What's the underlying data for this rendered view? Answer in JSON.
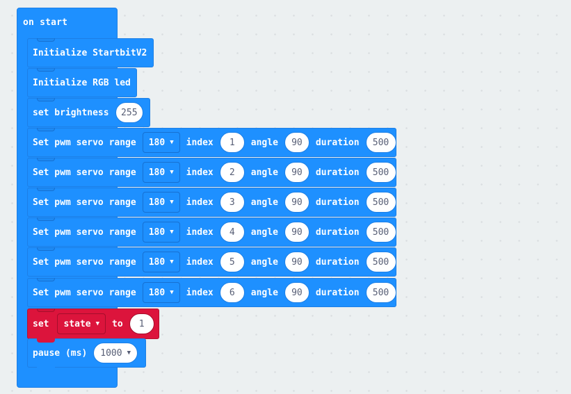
{
  "hat": {
    "label": "on start"
  },
  "blocks": {
    "init_startbit": {
      "label": "Initialize StartbitV2"
    },
    "init_rgb": {
      "label": "Initialize RGB led"
    },
    "brightness": {
      "label": "set brightness",
      "value": "255"
    },
    "servo_labels": {
      "prefix": "Set pwm servo range",
      "index": "index",
      "angle": "angle",
      "duration": "duration"
    },
    "servos": [
      {
        "range": "180",
        "index": "1",
        "angle": "90",
        "duration": "500"
      },
      {
        "range": "180",
        "index": "2",
        "angle": "90",
        "duration": "500"
      },
      {
        "range": "180",
        "index": "3",
        "angle": "90",
        "duration": "500"
      },
      {
        "range": "180",
        "index": "4",
        "angle": "90",
        "duration": "500"
      },
      {
        "range": "180",
        "index": "5",
        "angle": "90",
        "duration": "500"
      },
      {
        "range": "180",
        "index": "6",
        "angle": "90",
        "duration": "500"
      }
    ],
    "set_var": {
      "label": "set",
      "variable": "state",
      "to": "to",
      "value": "1"
    },
    "pause": {
      "label": "pause (ms)",
      "value": "1000"
    }
  },
  "colors": {
    "background": "#ecf0f1",
    "block_blue": "#1e90ff",
    "block_red": "#dc143c",
    "field_text": "#575e75"
  },
  "icons": {
    "dropdown": "caret-down-icon"
  }
}
